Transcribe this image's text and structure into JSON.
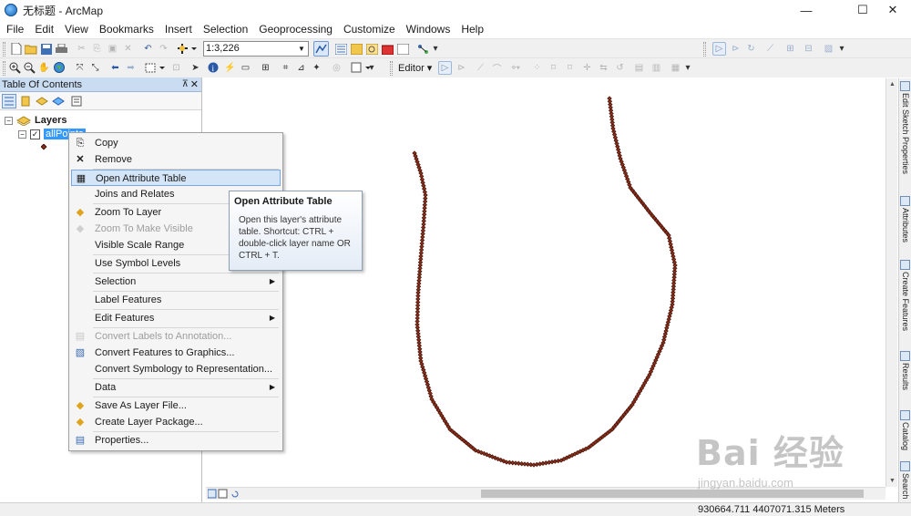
{
  "window": {
    "title": "无标题 - ArcMap",
    "minimize_glyph": "—",
    "maximize_glyph": "☐",
    "close_glyph": "✕"
  },
  "menubar": [
    "File",
    "Edit",
    "View",
    "Bookmarks",
    "Insert",
    "Selection",
    "Geoprocessing",
    "Customize",
    "Windows",
    "Help"
  ],
  "toolbar": {
    "scale": "1:3,226",
    "editor_label": "Editor ▾"
  },
  "toc": {
    "title": "Table Of Contents",
    "pin_glyph": "⊼",
    "close_glyph": "✕",
    "group_name": "Layers",
    "layer_name": "allPoints",
    "layer_checked": true
  },
  "context_menu": {
    "items": [
      {
        "label": "Copy",
        "icon": "copy-icon",
        "glyph": "⎘",
        "enabled": true
      },
      {
        "label": "Remove",
        "icon": "remove-icon",
        "glyph": "✕",
        "enabled": true
      },
      {
        "label": "Open Attribute Table",
        "icon": "table-icon",
        "glyph": "▦",
        "enabled": true,
        "highlighted": true
      },
      {
        "label": "Joins and Relates",
        "enabled": true,
        "submenu": true
      },
      {
        "label": "Zoom To Layer",
        "icon": "zoom-layer-icon",
        "glyph": "◆",
        "enabled": true
      },
      {
        "label": "Zoom To Make Visible",
        "icon": "zoom-visible-icon",
        "glyph": "◆",
        "enabled": false
      },
      {
        "label": "Visible Scale Range",
        "enabled": true,
        "submenu": true
      },
      {
        "label": "Use Symbol Levels",
        "enabled": true
      },
      {
        "label": "Selection",
        "enabled": true,
        "submenu": true
      },
      {
        "label": "Label Features",
        "enabled": true
      },
      {
        "label": "Edit Features",
        "enabled": true,
        "submenu": true
      },
      {
        "label": "Convert Labels to Annotation...",
        "icon": "convert-labels-icon",
        "glyph": "▤",
        "enabled": false
      },
      {
        "label": "Convert Features to Graphics...",
        "icon": "convert-graphics-icon",
        "glyph": "▧",
        "enabled": true
      },
      {
        "label": "Convert Symbology to Representation...",
        "enabled": true
      },
      {
        "label": "Data",
        "enabled": true,
        "submenu": true
      },
      {
        "label": "Save As Layer File...",
        "icon": "save-layer-icon",
        "glyph": "◆",
        "enabled": true
      },
      {
        "label": "Create Layer Package...",
        "icon": "layer-package-icon",
        "glyph": "◆",
        "enabled": true
      },
      {
        "label": "Properties...",
        "icon": "properties-icon",
        "glyph": "▤",
        "enabled": true
      }
    ]
  },
  "tooltip": {
    "title": "Open Attribute Table",
    "body": "Open this layer's attribute table. Shortcut: CTRL + double-click layer name OR CTRL + T."
  },
  "right_dock": [
    "Edit Sketch Properties",
    "Attributes",
    "Create Features",
    "Results",
    "Catalog",
    "Search"
  ],
  "status": {
    "coordinates": "930664.711  4407071.315 Meters"
  },
  "watermark": {
    "big": "Bai 经验",
    "small": "jingyan.baidu.com"
  },
  "colors": {
    "point_fill": "#8b2e1a",
    "point_stroke": "#3a0f05",
    "selection_blue": "#3399ff",
    "menu_highlight": "#d4e5f8"
  }
}
